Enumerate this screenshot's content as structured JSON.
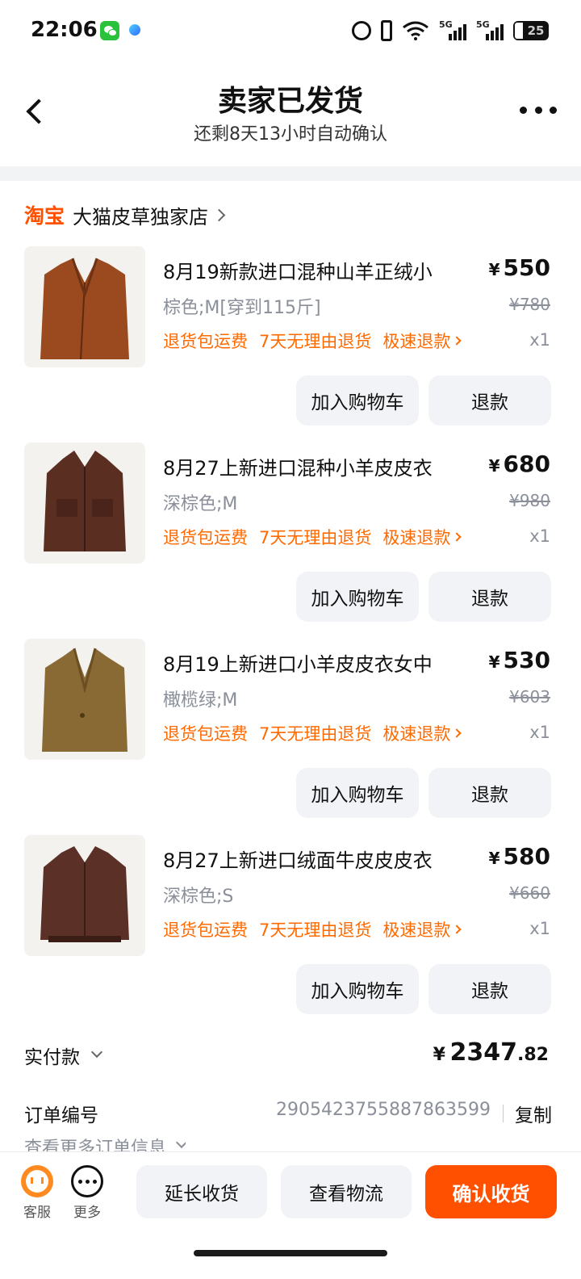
{
  "status_bar": {
    "time": "22:06",
    "battery": "25",
    "signal1": "5G",
    "signal2": "5G",
    "icons": [
      "wechat-icon",
      "app-icon",
      "alarm-icon",
      "vibrate-icon",
      "wifi-icon",
      "signal-icon",
      "signal-icon",
      "battery-icon"
    ]
  },
  "header": {
    "title": "卖家已发货",
    "subtitle": "还剩8天13小时自动确认"
  },
  "shop": {
    "logo_text": "淘宝",
    "name": "大猫皮草独家店"
  },
  "items": [
    {
      "title": "8月19新款进口混种山羊正绒小",
      "price": "550",
      "sku": "棕色;M[穿到115斤]",
      "original_price": "¥780",
      "qty": "x1",
      "color": "#9a4a1e"
    },
    {
      "title": "8月27上新进口混种小羊皮皮衣",
      "price": "680",
      "sku": "深棕色;M",
      "original_price": "¥980",
      "qty": "x1",
      "color": "#5a2f22"
    },
    {
      "title": "8月19上新进口小羊皮皮衣女中",
      "price": "530",
      "sku": "橄榄绿;M",
      "original_price": "¥603",
      "qty": "x1",
      "color": "#8a6a34"
    },
    {
      "title": "8月27上新进口绒面牛皮皮皮衣",
      "price": "580",
      "sku": "深棕色;S",
      "original_price": "¥660",
      "qty": "x1",
      "color": "#5b3026"
    }
  ],
  "tags": {
    "t1": "退货包运费",
    "t2": "7天无理由退货",
    "t3": "极速退款"
  },
  "buttons": {
    "add_cart": "加入购物车",
    "refund": "退款"
  },
  "currency": "¥",
  "payment": {
    "label": "实付款",
    "currency": "¥",
    "amount_int": "2347",
    "amount_dec": ".82"
  },
  "order": {
    "label": "订单编号",
    "number": "2905423755887863599",
    "copy": "复制",
    "more": "查看更多订单信息"
  },
  "bottom_bar": {
    "service": "客服",
    "more": "更多",
    "extend": "延长收货",
    "logistics": "查看物流",
    "confirm": "确认收货"
  },
  "colors": {
    "accent": "#ff5000",
    "tag": "#ff6a00",
    "muted": "#8a8f99",
    "button_bg": "#f1f3f7"
  }
}
